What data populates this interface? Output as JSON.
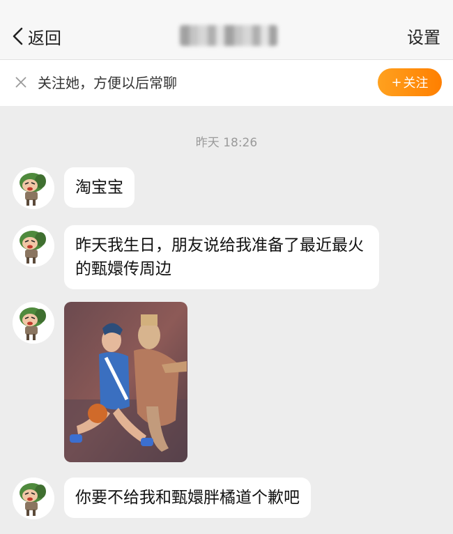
{
  "header": {
    "back_label": "返回",
    "settings_label": "设置"
  },
  "follow_bar": {
    "tip_text": "关注她，方便以后常聊",
    "follow_label": "关注",
    "follow_plus": "+"
  },
  "chat": {
    "timestamp": "昨天 18:26",
    "messages": [
      {
        "type": "text",
        "text": "淘宝宝"
      },
      {
        "type": "text",
        "text": "昨天我生日，朋友说给我准备了最近最火的甄嬛传周边"
      },
      {
        "type": "image",
        "alt": "photo-of-dolls"
      },
      {
        "type": "text",
        "text": "你要不给我和甄嬛胖橘道个歉吧"
      }
    ]
  },
  "colors": {
    "follow_button": "#ff8f10",
    "background": "#ededed",
    "avatar_green": "#5a8a4a"
  }
}
